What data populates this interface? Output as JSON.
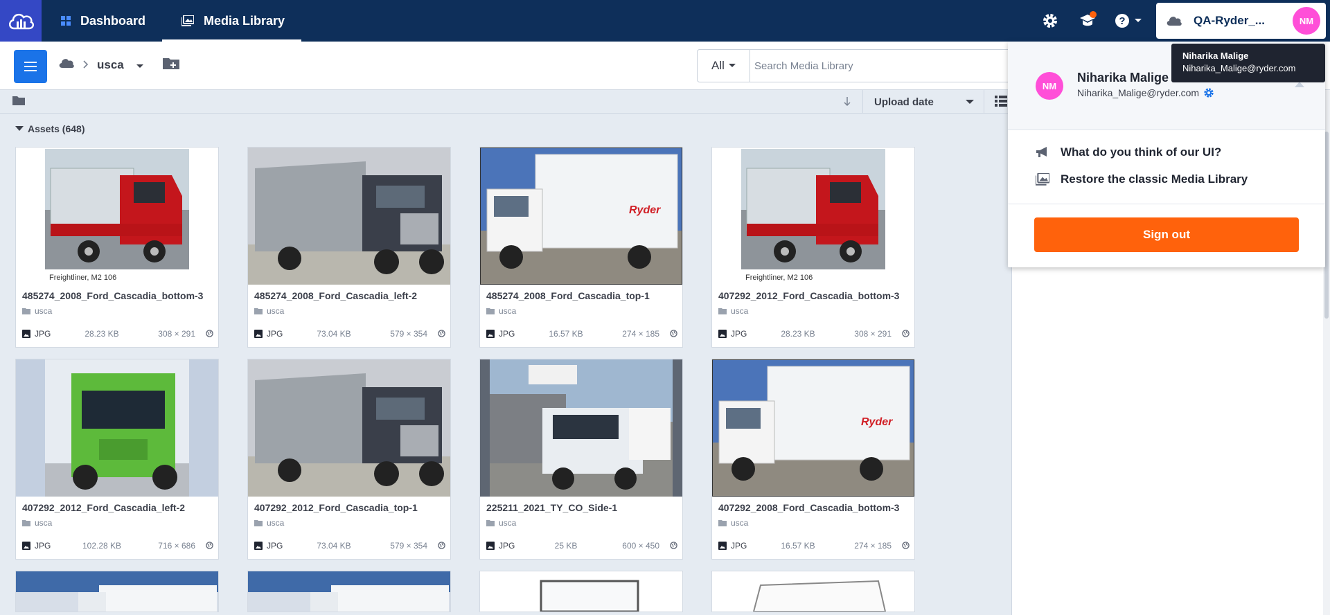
{
  "nav": {
    "dashboard": "Dashboard",
    "media_library": "Media Library",
    "account_name": "QA-Ryder_...",
    "avatar_initials": "NM"
  },
  "toolbar": {
    "breadcrumb_folder": "usca",
    "search_scope": "All",
    "search_placeholder": "Search Media Library"
  },
  "sort": {
    "selected": "Upload date"
  },
  "assets": {
    "heading": "Assets (648)",
    "items": [
      {
        "title": "485274_2008_Ford_Cascadia_bottom-3",
        "folder": "usca",
        "format": "JPG",
        "size": "28.23 KB",
        "dims": "308 × 291",
        "caption": "Freightliner, M2 106"
      },
      {
        "title": "485274_2008_Ford_Cascadia_left-2",
        "folder": "usca",
        "format": "JPG",
        "size": "73.04 KB",
        "dims": "579 × 354"
      },
      {
        "title": "485274_2008_Ford_Cascadia_top-1",
        "folder": "usca",
        "format": "JPG",
        "size": "16.57 KB",
        "dims": "274 × 185"
      },
      {
        "title": "407292_2012_Ford_Cascadia_bottom-3",
        "folder": "usca",
        "format": "JPG",
        "size": "28.23 KB",
        "dims": "308 × 291",
        "caption": "Freightliner, M2 106"
      },
      {
        "title": "407292_2012_Ford_Cascadia_left-2",
        "folder": "usca",
        "format": "JPG",
        "size": "102.28 KB",
        "dims": "716 × 686"
      },
      {
        "title": "407292_2012_Ford_Cascadia_top-1",
        "folder": "usca",
        "format": "JPG",
        "size": "73.04 KB",
        "dims": "579 × 354"
      },
      {
        "title": "225211_2021_TY_CO_Side-1",
        "folder": "usca",
        "format": "JPG",
        "size": "25 KB",
        "dims": "600 × 450"
      },
      {
        "title": "407292_2008_Ford_Cascadia_bottom-3",
        "folder": "usca",
        "format": "JPG",
        "size": "16.57 KB",
        "dims": "274 × 185"
      }
    ]
  },
  "account_menu": {
    "name": "Niharika Malige",
    "email": "Niharika_Malige@ryder.com",
    "feedback": "What do you think of our UI?",
    "restore": "Restore the classic Media Library",
    "signout": "Sign out"
  },
  "tooltip": {
    "name": "Niharika Malige",
    "email": "Niharika_Malige@ryder.com"
  },
  "colors": {
    "topbar": "#0e2f5a",
    "accent": "#1a73e8",
    "signout": "#ff620c",
    "avatar": "#ff4fd8"
  }
}
